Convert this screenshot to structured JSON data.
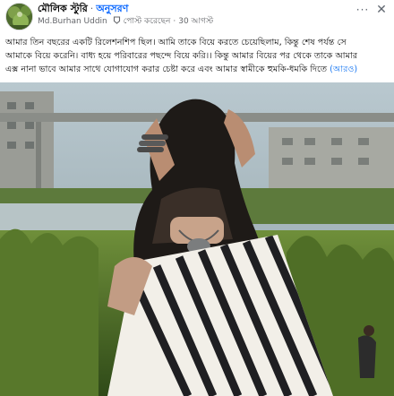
{
  "post": {
    "group_name": "মৌলিক স্টুরি",
    "separator": "·",
    "follow_label": "অনুসরণ",
    "author": "Md.Burhan Uddin",
    "badge_text": "পোস্ট করেছেন",
    "date_dot": "·",
    "date": "30 আগস্ট",
    "more_icon": "more-dots-icon",
    "close_icon": "close-icon",
    "text_lines": [
      "আমার তিন বছরের একটি রিলেশনশিপ ছিল। আমি তাকে বিয়ে করতে চেয়েছিলাম, কিন্তু শেষ পর্যন্ত সে",
      "আমাকে বিয়ে করেনি। বাধ্য হয়ে পরিবারের পছন্দে বিয়ে করি।। কিন্তু আমার বিয়ের পর থেকে তাকে আমার",
      "এক্স নানা ভাবে আমার সাথে যোগাযোগ করার চেষ্টা করে এবং আমার স্বামীকে হুমকি-ধমকি দিতে"
    ],
    "see_more": "(আরও)"
  },
  "colors": {
    "link_blue": "#0866ff",
    "secondary_text": "#65676b",
    "primary_text": "#050505"
  }
}
